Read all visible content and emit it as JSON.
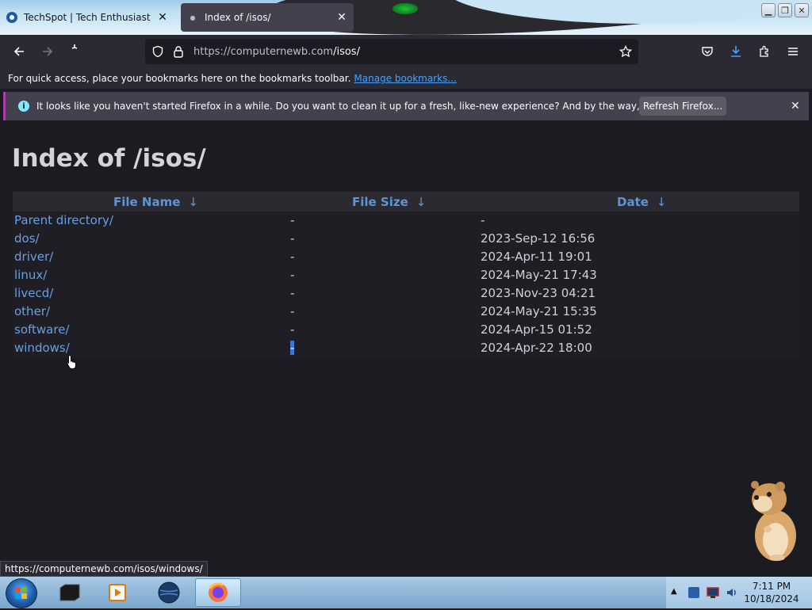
{
  "browser": {
    "tabs": [
      {
        "label": "TechSpot | Tech Enthusiasts, Po",
        "active": false
      },
      {
        "label": "Index of /isos/",
        "active": true
      }
    ],
    "url_host": "https://computernewb.com",
    "url_path": "/isos/"
  },
  "bookmarks_bar": {
    "text": "For quick access, place your bookmarks here on the bookmarks toolbar.",
    "link": "Manage bookmarks..."
  },
  "notification": {
    "text": "It looks like you haven't started Firefox in a while. Do you want to clean it up for a fresh, like-new experience? And by the way, welcome back!",
    "button": "Refresh Firefox..."
  },
  "page": {
    "title": "Index of /isos/",
    "columns": [
      "File Name",
      "File Size",
      "Date"
    ],
    "sort_arrow": "↓",
    "rows": [
      {
        "name": "Parent directory/",
        "size": "-",
        "date": "-"
      },
      {
        "name": "dos/",
        "size": "-",
        "date": "2023-Sep-12 16:56"
      },
      {
        "name": "driver/",
        "size": "-",
        "date": "2024-Apr-11 19:01"
      },
      {
        "name": "linux/",
        "size": "-",
        "date": "2024-May-21 17:43"
      },
      {
        "name": "livecd/",
        "size": "-",
        "date": "2023-Nov-23 04:21"
      },
      {
        "name": "other/",
        "size": "-",
        "date": "2024-May-21 15:35"
      },
      {
        "name": "software/",
        "size": "-",
        "date": "2024-Apr-15 01:52"
      },
      {
        "name": "windows/",
        "size": "-",
        "date": "2024-Apr-22 18:00"
      }
    ]
  },
  "status_url": "https://computernewb.com/isos/windows/",
  "taskbar": {
    "time": "7:11 PM",
    "date": "10/18/2024"
  },
  "colors": {
    "link": "#6a9fe3",
    "header_bg": "#2a2a30",
    "accent": "#ae3ea9"
  }
}
